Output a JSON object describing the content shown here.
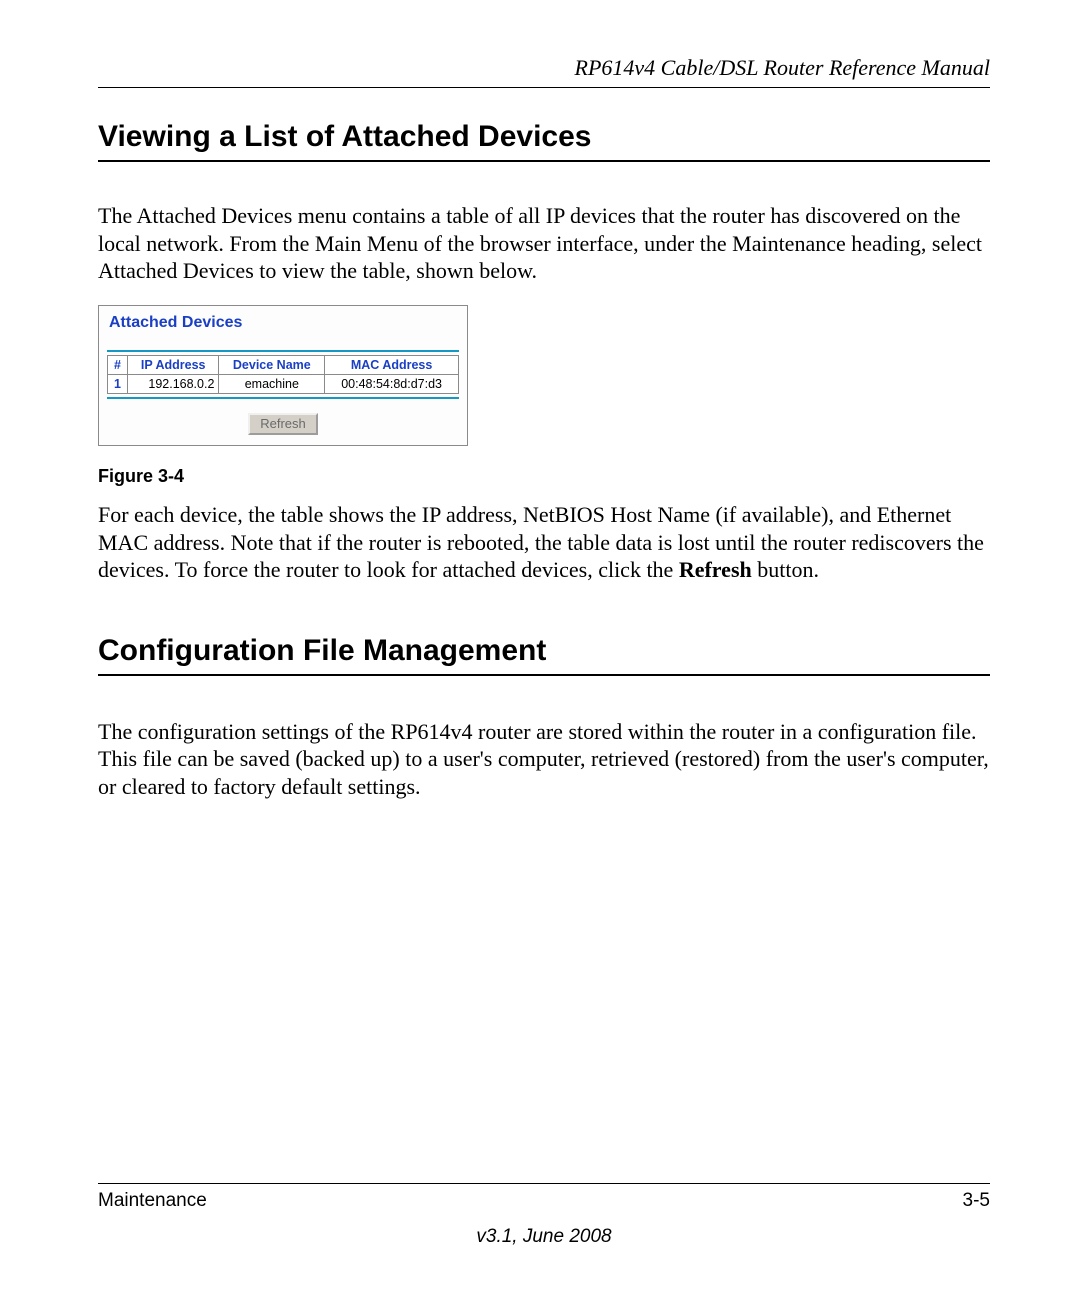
{
  "runningHead": "RP614v4 Cable/DSL Router Reference Manual",
  "section1": {
    "title": "Viewing a List of Attached Devices",
    "para1": "The Attached Devices menu contains a table of all IP devices that the router has discovered on the local network. From the Main Menu of the browser interface, under the Maintenance heading, select Attached Devices to view the table, shown below.",
    "panelTitle": "Attached Devices",
    "table": {
      "headers": {
        "num": "#",
        "ip": "IP Address",
        "name": "Device Name",
        "mac": "MAC Address"
      },
      "row": {
        "num": "1",
        "ip": "192.168.0.2",
        "name": "emachine",
        "mac": "00:48:54:8d:d7:d3"
      }
    },
    "refresh": "Refresh",
    "figureCaption": "Figure 3-4",
    "para2a": "For each device, the table shows the IP address, NetBIOS Host Name (if available), and Ethernet MAC address. Note that if the router is rebooted, the table data is lost until the router rediscovers the devices. To force the router to look for attached devices, click the ",
    "para2bold": "Refresh",
    "para2b": " button."
  },
  "section2": {
    "title": "Configuration File Management",
    "para1": "The configuration settings of the RP614v4 router are stored within the router in a configuration file. This file can be saved (backed up) to a user's computer, retrieved (restored) from the user's computer, or cleared to factory default settings."
  },
  "footer": {
    "left": "Maintenance",
    "right": "3-5",
    "version": "v3.1, June 2008"
  }
}
